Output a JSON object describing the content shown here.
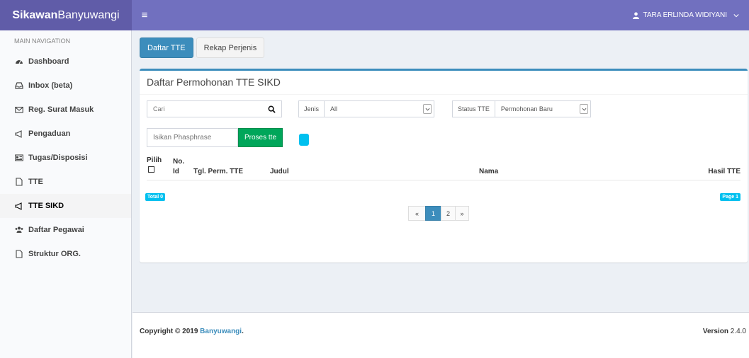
{
  "header": {
    "logo_bold": "Sikawan",
    "logo_rest": "Banyuwangi",
    "toggle_icon": "≡",
    "user_name": "TARA ERLINDA WIDIYANI"
  },
  "sidebar": {
    "header": "MAIN NAVIGATION",
    "items": [
      {
        "label": "Dashboard",
        "icon": "dashboard-icon"
      },
      {
        "label": "Inbox (beta)",
        "icon": "inbox-icon"
      },
      {
        "label": "Reg. Surat Masuk",
        "icon": "envelope-icon"
      },
      {
        "label": "Pengaduan",
        "icon": "megaphone-icon"
      },
      {
        "label": "Tugas/Disposisi",
        "icon": "id-card-icon"
      },
      {
        "label": "TTE",
        "icon": "file-icon"
      },
      {
        "label": "TTE SIKD",
        "icon": "megaphone-icon",
        "active": true
      },
      {
        "label": "Daftar Pegawai",
        "icon": "users-icon"
      },
      {
        "label": "Struktur ORG.",
        "icon": "file-icon"
      }
    ]
  },
  "main": {
    "tabs": [
      {
        "label": "Daftar TTE",
        "active": true
      },
      {
        "label": "Rekap Perjenis",
        "active": false
      }
    ],
    "box_title": "Daftar Permohonan TTE SIKD",
    "search": {
      "placeholder": "Cari",
      "value": ""
    },
    "jenis": {
      "label": "Jenis",
      "value": "All"
    },
    "status": {
      "label": "Status TTE",
      "value": "Permohonan Baru"
    },
    "phrase": {
      "placeholder": "Isikan Phasphrase",
      "value": ""
    },
    "process_button": "Proses tte",
    "table": {
      "col_pilih": "Pilih",
      "col_no_1": "No.",
      "col_no_2": "Id",
      "col_tgl": "Tgl. Perm. TTE",
      "col_judul": "Judul",
      "col_nama": "Nama",
      "col_hasil": "Hasil TTE",
      "rows": []
    },
    "total_badge": "Total 0",
    "page_badge": "Page 1",
    "pagination": {
      "prev": "«",
      "pages": [
        "1",
        "2"
      ],
      "current": "1",
      "next": "»"
    }
  },
  "footer": {
    "copy_prefix": "Copyright © 2019 ",
    "copy_link": "Banyuwangi",
    "copy_suffix": ".",
    "version_label": "Version",
    "version_value": " 2.4.0"
  },
  "colors": {
    "logo_bg": "#605ca8",
    "navbar_bg": "#7170bf",
    "primary": "#3c8dbc",
    "success": "#00a65a",
    "info": "#00c0ef"
  }
}
